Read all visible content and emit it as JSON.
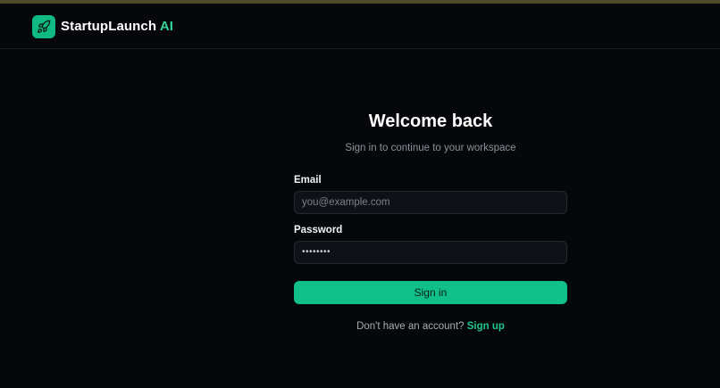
{
  "brand": {
    "name": "StartupLaunch",
    "accent": "AI",
    "icon": "rocket-icon",
    "accent_color": "#34d399"
  },
  "login": {
    "title": "Welcome back",
    "subtitle": "Sign in to continue to your workspace",
    "email_label": "Email",
    "email_placeholder": "you@example.com",
    "email_value": "",
    "password_label": "Password",
    "password_value": "••••••••",
    "submit_label": "Sign in",
    "signup_prompt": "Don't have an account?",
    "signup_link": "Sign up"
  },
  "colors": {
    "background": "#05070a",
    "primary": "#10c088",
    "link": "#22c58b"
  }
}
